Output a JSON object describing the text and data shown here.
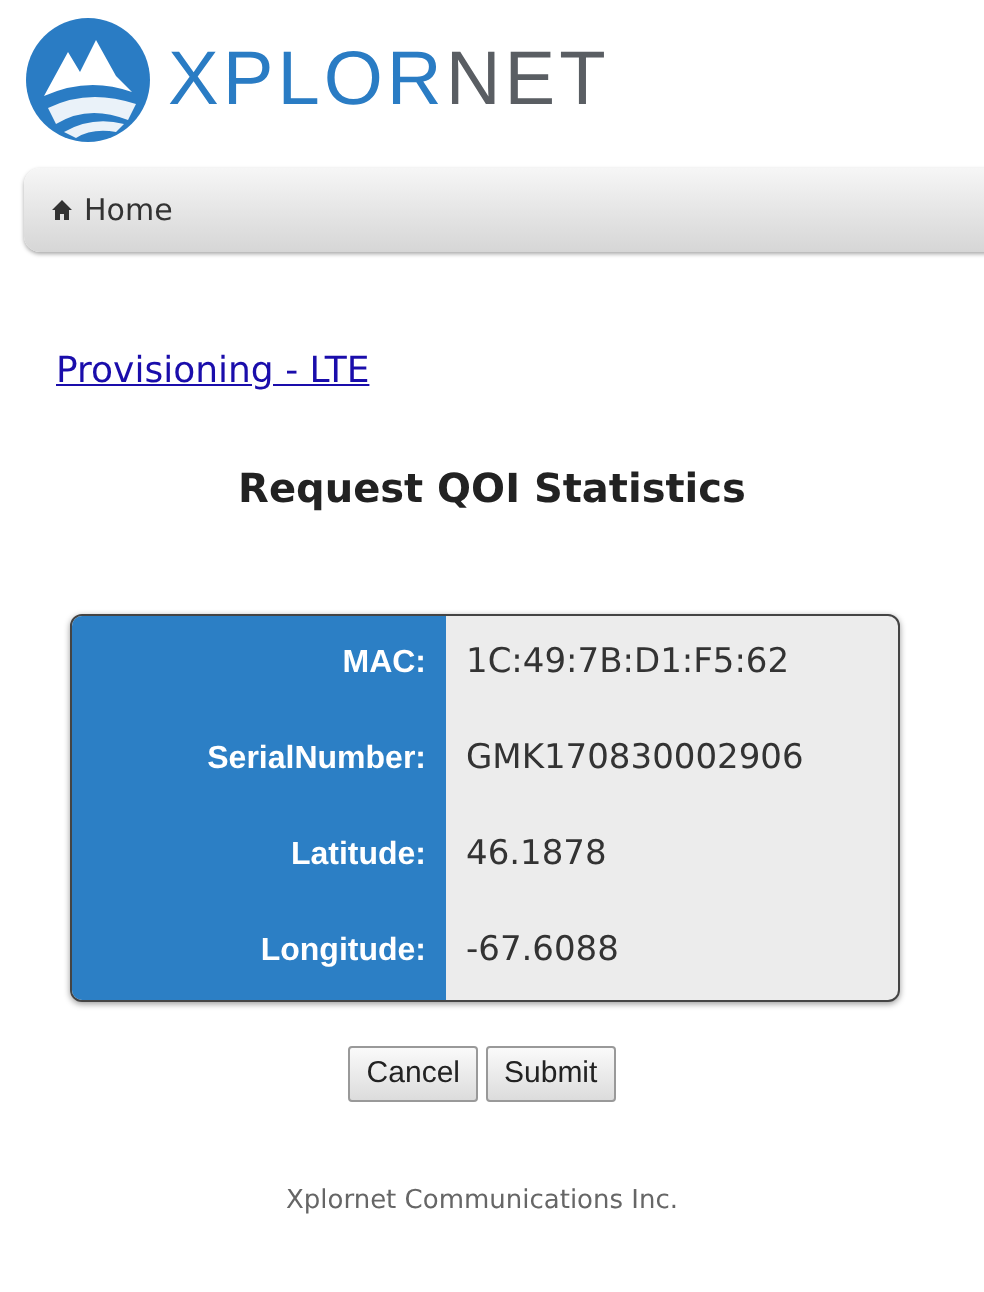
{
  "logo": {
    "parts": [
      {
        "text": "XPLOR",
        "color": "#2a7cc4"
      },
      {
        "text": "NET",
        "color": "#5a5e63"
      }
    ]
  },
  "nav": {
    "items": [
      {
        "label": "Home"
      }
    ]
  },
  "breadcrumb_link": "Provisioning - LTE",
  "title": "Request QOI Statistics",
  "fields": [
    {
      "label": "MAC:",
      "value": "1C:49:7B:D1:F5:62"
    },
    {
      "label": "SerialNumber:",
      "value": "GMK170830002906"
    },
    {
      "label": "Latitude:",
      "value": "46.1878"
    },
    {
      "label": "Longitude:",
      "value": "-67.6088"
    }
  ],
  "buttons": [
    "Cancel",
    "Submit"
  ],
  "footer": "Xplornet Communications Inc."
}
